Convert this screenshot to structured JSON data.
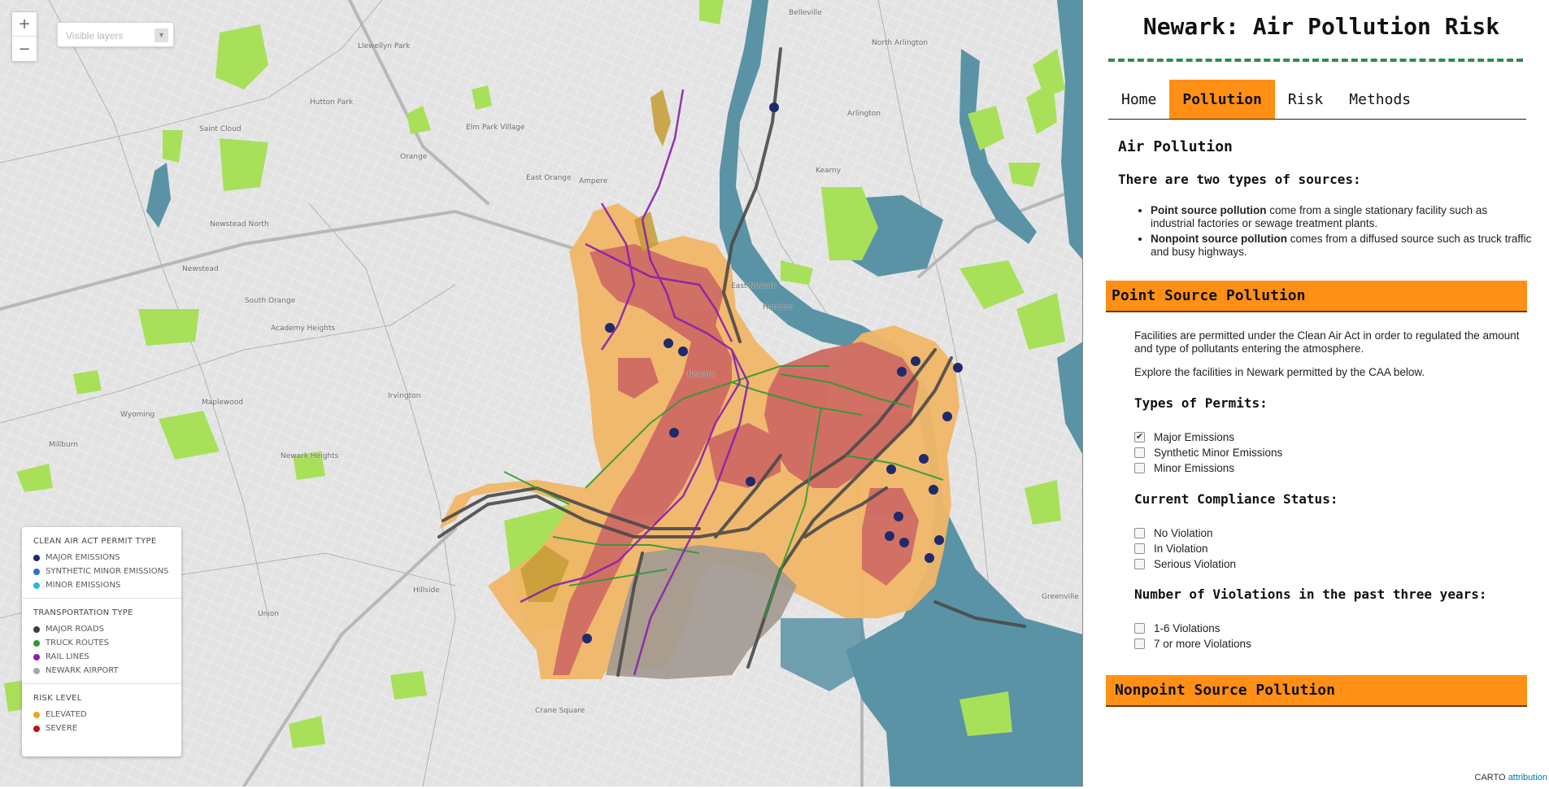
{
  "map": {
    "zoom_in": "+",
    "zoom_out": "−",
    "layer_placeholder": "Visible layers",
    "place_labels": [
      "Belleville",
      "Llewellyn Park",
      "North Arlington",
      "Hutton Park",
      "Saint Cloud",
      "Elm Park Village",
      "Arlington",
      "Orange",
      "East Orange",
      "Ampere",
      "Kearny",
      "Newstead North",
      "Newstead",
      "South Orange",
      "East Newark",
      "Harrison",
      "Academy Heights",
      "Irvington",
      "Maplewood",
      "Wyoming",
      "Newark Heights",
      "Millburn",
      "Newark",
      "Hillside",
      "Union",
      "Crane Square",
      "Greenville"
    ],
    "attribution_brand": "CARTO",
    "attribution_link": "attribution"
  },
  "legend": {
    "permit_title": "CLEAN AIR ACT PERMIT TYPE",
    "permit_items": [
      {
        "label": "MAJOR EMISSIONS",
        "color": "#1f2a6b"
      },
      {
        "label": "SYNTHETIC MINOR EMISSIONS",
        "color": "#2b6fd6"
      },
      {
        "label": "MINOR EMISSIONS",
        "color": "#2bb8e8"
      }
    ],
    "transport_title": "TRANSPORTATION TYPE",
    "transport_items": [
      {
        "label": "MAJOR ROADS",
        "color": "#3e3e3e"
      },
      {
        "label": "TRUCK ROUTES",
        "color": "#2f9a35"
      },
      {
        "label": "RAIL LINES",
        "color": "#8a1fae"
      },
      {
        "label": "NEWARK AIRPORT",
        "color": "#a7a7a7"
      }
    ],
    "risk_title": "RISK LEVEL",
    "risk_items": [
      {
        "label": "ELEVATED",
        "color": "#f0a31a"
      },
      {
        "label": "SEVERE",
        "color": "#b51414"
      }
    ]
  },
  "panel": {
    "title": "Newark: Air Pollution Risk",
    "tabs": [
      {
        "label": "Home",
        "active": false
      },
      {
        "label": "Pollution",
        "active": true
      },
      {
        "label": "Risk",
        "active": false
      },
      {
        "label": "Methods",
        "active": false
      }
    ],
    "section_title": "Air Pollution",
    "sources_intro": "There are two types of sources:",
    "sources": [
      {
        "term": "Point source pollution",
        "text": " come from a single stationary facility such as industrial factories or sewage treatment plants."
      },
      {
        "term": "Nonpoint source pollution",
        "text": " comes from a diffused source such as truck traffic and busy highways."
      }
    ],
    "point_header": "Point Source Pollution",
    "point_para1": "Facilities are permitted under the Clean Air Act in order to regulated the amount and type of pollutants entering the atmosphere.",
    "point_para2": "Explore the facilities in Newark permitted by the CAA below.",
    "permits_title": "Types of Permits:",
    "permits": [
      {
        "label": "Major Emissions",
        "checked": true
      },
      {
        "label": "Synthetic Minor Emissions",
        "checked": false
      },
      {
        "label": "Minor Emissions",
        "checked": false
      }
    ],
    "compliance_title": "Current Compliance Status:",
    "compliance": [
      {
        "label": "No Violation",
        "checked": false
      },
      {
        "label": "In Violation",
        "checked": false
      },
      {
        "label": "Serious Violation",
        "checked": false
      }
    ],
    "violations_title": "Number of Violations in the past three years:",
    "violations": [
      {
        "label": "1-6 Violations",
        "checked": false
      },
      {
        "label": "7 or more Violations",
        "checked": false
      }
    ],
    "nonpoint_header": "Nonpoint Source Pollution"
  },
  "colors": {
    "accent_orange": "#ff9015",
    "dash_green": "#2e8b57",
    "water": "#5a93a6",
    "park": "#a8e05a",
    "elevated": "#f0b667",
    "severe": "#cf6b63"
  }
}
